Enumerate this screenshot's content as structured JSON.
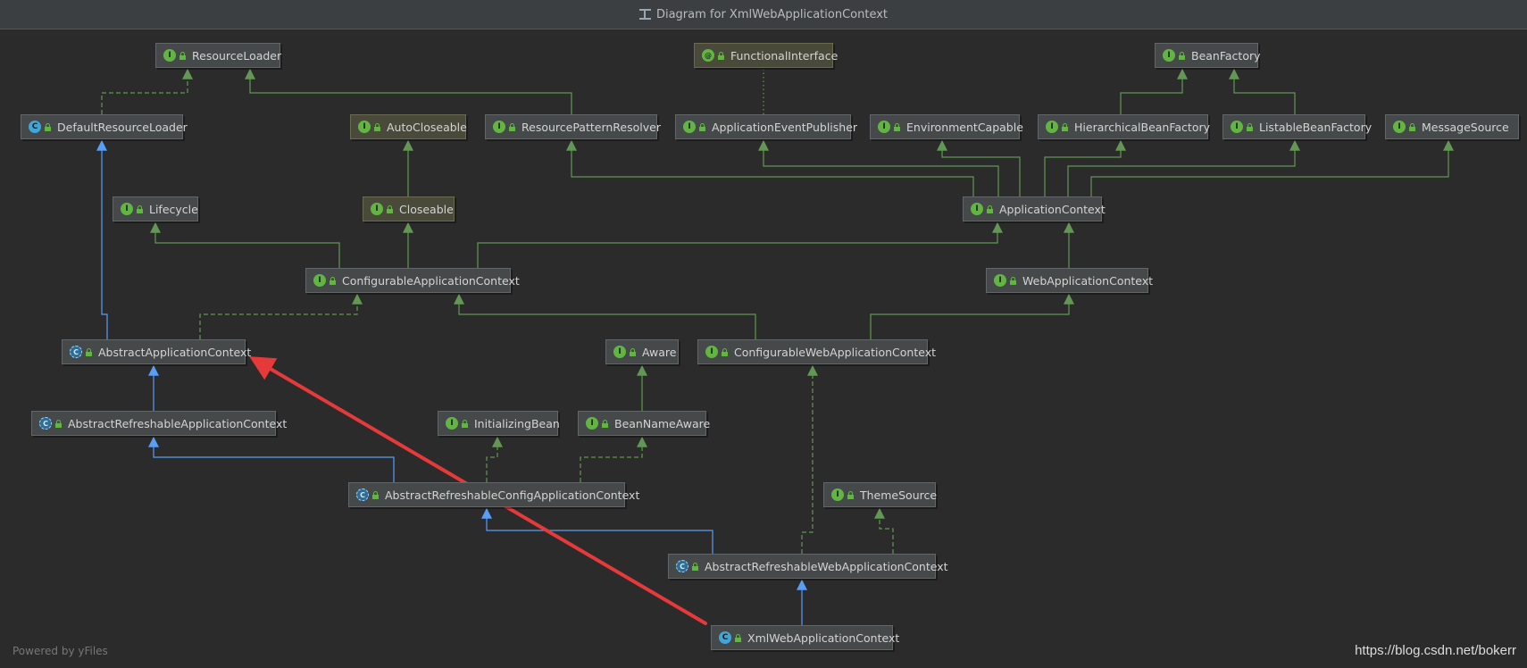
{
  "window": {
    "title": "Diagram for XmlWebApplicationContext"
  },
  "footer": {
    "powered": "Powered by yFiles",
    "credit": "https://blog.csdn.net/bokerr"
  },
  "colors": {
    "implements_edge": "#629755",
    "extends_edge": "#589df6",
    "highlight_arrow": "#e63a3a"
  },
  "nodes": [
    {
      "id": "ResourceLoader",
      "label": "ResourceLoader",
      "kind": "interface"
    },
    {
      "id": "FunctionalInterface",
      "label": "FunctionalInterface",
      "kind": "annotation"
    },
    {
      "id": "BeanFactory",
      "label": "BeanFactory",
      "kind": "interface"
    },
    {
      "id": "DefaultResourceLoader",
      "label": "DefaultResourceLoader",
      "kind": "class"
    },
    {
      "id": "AutoCloseable",
      "label": "AutoCloseable",
      "kind": "interface",
      "tint": "java"
    },
    {
      "id": "ResourcePatternResolver",
      "label": "ResourcePatternResolver",
      "kind": "interface"
    },
    {
      "id": "ApplicationEventPublisher",
      "label": "ApplicationEventPublisher",
      "kind": "interface"
    },
    {
      "id": "EnvironmentCapable",
      "label": "EnvironmentCapable",
      "kind": "interface"
    },
    {
      "id": "HierarchicalBeanFactory",
      "label": "HierarchicalBeanFactory",
      "kind": "interface"
    },
    {
      "id": "ListableBeanFactory",
      "label": "ListableBeanFactory",
      "kind": "interface"
    },
    {
      "id": "MessageSource",
      "label": "MessageSource",
      "kind": "interface"
    },
    {
      "id": "Lifecycle",
      "label": "Lifecycle",
      "kind": "interface"
    },
    {
      "id": "Closeable",
      "label": "Closeable",
      "kind": "interface",
      "tint": "java"
    },
    {
      "id": "ApplicationContext",
      "label": "ApplicationContext",
      "kind": "interface"
    },
    {
      "id": "ConfigurableApplicationContext",
      "label": "ConfigurableApplicationContext",
      "kind": "interface"
    },
    {
      "id": "WebApplicationContext",
      "label": "WebApplicationContext",
      "kind": "interface"
    },
    {
      "id": "AbstractApplicationContext",
      "label": "AbstractApplicationContext",
      "kind": "abstract"
    },
    {
      "id": "Aware",
      "label": "Aware",
      "kind": "interface"
    },
    {
      "id": "ConfigurableWebApplicationContext",
      "label": "ConfigurableWebApplicationContext",
      "kind": "interface"
    },
    {
      "id": "AbstractRefreshableApplicationContext",
      "label": "AbstractRefreshableApplicationContext",
      "kind": "abstract"
    },
    {
      "id": "InitializingBean",
      "label": "InitializingBean",
      "kind": "interface"
    },
    {
      "id": "BeanNameAware",
      "label": "BeanNameAware",
      "kind": "interface"
    },
    {
      "id": "AbstractRefreshableConfigApplicationContext",
      "label": "AbstractRefreshableConfigApplicationContext",
      "kind": "abstract"
    },
    {
      "id": "ThemeSource",
      "label": "ThemeSource",
      "kind": "interface"
    },
    {
      "id": "AbstractRefreshableWebApplicationContext",
      "label": "AbstractRefreshableWebApplicationContext",
      "kind": "abstract"
    },
    {
      "id": "XmlWebApplicationContext",
      "label": "XmlWebApplicationContext",
      "kind": "class"
    }
  ],
  "edges": [
    {
      "from": "DefaultResourceLoader",
      "to": "ResourceLoader",
      "type": "implements"
    },
    {
      "from": "ResourcePatternResolver",
      "to": "ResourceLoader",
      "type": "extends-interface"
    },
    {
      "from": "ApplicationEventPublisher",
      "to": "FunctionalInterface",
      "type": "annotated"
    },
    {
      "from": "HierarchicalBeanFactory",
      "to": "BeanFactory",
      "type": "extends-interface"
    },
    {
      "from": "ListableBeanFactory",
      "to": "BeanFactory",
      "type": "extends-interface"
    },
    {
      "from": "Closeable",
      "to": "AutoCloseable",
      "type": "extends-interface"
    },
    {
      "from": "ApplicationContext",
      "to": "ResourcePatternResolver",
      "type": "extends-interface"
    },
    {
      "from": "ApplicationContext",
      "to": "ApplicationEventPublisher",
      "type": "extends-interface"
    },
    {
      "from": "ApplicationContext",
      "to": "EnvironmentCapable",
      "type": "extends-interface"
    },
    {
      "from": "ApplicationContext",
      "to": "HierarchicalBeanFactory",
      "type": "extends-interface"
    },
    {
      "from": "ApplicationContext",
      "to": "ListableBeanFactory",
      "type": "extends-interface"
    },
    {
      "from": "ApplicationContext",
      "to": "MessageSource",
      "type": "extends-interface"
    },
    {
      "from": "ConfigurableApplicationContext",
      "to": "Lifecycle",
      "type": "extends-interface"
    },
    {
      "from": "ConfigurableApplicationContext",
      "to": "Closeable",
      "type": "extends-interface"
    },
    {
      "from": "ConfigurableApplicationContext",
      "to": "ApplicationContext",
      "type": "extends-interface"
    },
    {
      "from": "WebApplicationContext",
      "to": "ApplicationContext",
      "type": "extends-interface"
    },
    {
      "from": "AbstractApplicationContext",
      "to": "DefaultResourceLoader",
      "type": "extends"
    },
    {
      "from": "AbstractApplicationContext",
      "to": "ConfigurableApplicationContext",
      "type": "implements"
    },
    {
      "from": "ConfigurableWebApplicationContext",
      "to": "ConfigurableApplicationContext",
      "type": "extends-interface"
    },
    {
      "from": "ConfigurableWebApplicationContext",
      "to": "WebApplicationContext",
      "type": "extends-interface"
    },
    {
      "from": "BeanNameAware",
      "to": "Aware",
      "type": "extends-interface"
    },
    {
      "from": "AbstractRefreshableApplicationContext",
      "to": "AbstractApplicationContext",
      "type": "extends"
    },
    {
      "from": "AbstractRefreshableConfigApplicationContext",
      "to": "AbstractRefreshableApplicationContext",
      "type": "extends"
    },
    {
      "from": "AbstractRefreshableConfigApplicationContext",
      "to": "InitializingBean",
      "type": "implements"
    },
    {
      "from": "AbstractRefreshableConfigApplicationContext",
      "to": "BeanNameAware",
      "type": "implements"
    },
    {
      "from": "AbstractRefreshableWebApplicationContext",
      "to": "AbstractRefreshableConfigApplicationContext",
      "type": "extends"
    },
    {
      "from": "AbstractRefreshableWebApplicationContext",
      "to": "ConfigurableWebApplicationContext",
      "type": "implements"
    },
    {
      "from": "AbstractRefreshableWebApplicationContext",
      "to": "ThemeSource",
      "type": "implements"
    },
    {
      "from": "XmlWebApplicationContext",
      "to": "AbstractRefreshableWebApplicationContext",
      "type": "extends"
    }
  ]
}
